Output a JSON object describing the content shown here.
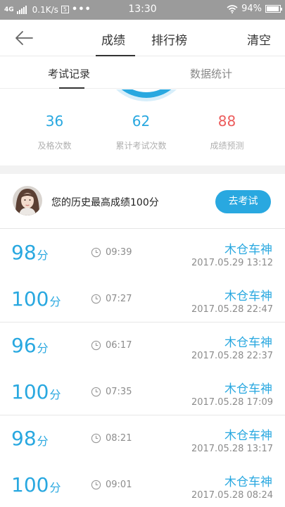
{
  "status_bar": {
    "network": "4G",
    "speed": "0.1K/s",
    "box_glyph": "5",
    "more": "•••",
    "time": "13:30",
    "battery": "94%",
    "battery_level": 0.94
  },
  "header": {
    "tabs": [
      {
        "label": "成绩",
        "active": true
      },
      {
        "label": "排行榜",
        "active": false
      }
    ],
    "clear_label": "清空",
    "back_icon": "arrow-left-icon"
  },
  "subtabs": [
    {
      "label": "考试记录",
      "active": true
    },
    {
      "label": "数据统计",
      "active": false
    }
  ],
  "stats": [
    {
      "value": "36",
      "label": "及格次数",
      "color": "#29a8e0"
    },
    {
      "value": "62",
      "label": "累计考试次数",
      "color": "#29a8e0"
    },
    {
      "value": "88",
      "label": "成绩预测",
      "color": "#ec5c5c"
    }
  ],
  "best": {
    "text": "您的历史最高成绩100分",
    "button_label": "去考试"
  },
  "records": [
    {
      "score": "98",
      "unit": "分",
      "duration": "09:39",
      "name": "木仓车神",
      "date": "2017.05.29   13:12"
    },
    {
      "score": "100",
      "unit": "分",
      "duration": "07:27",
      "name": "木仓车神",
      "date": "2017.05.28   22:47"
    },
    {
      "score": "96",
      "unit": "分",
      "duration": "06:17",
      "name": "木仓车神",
      "date": "2017.05.28   22:37"
    },
    {
      "score": "100",
      "unit": "分",
      "duration": "07:35",
      "name": "木仓车神",
      "date": "2017.05.28   17:09"
    },
    {
      "score": "98",
      "unit": "分",
      "duration": "08:21",
      "name": "木仓车神",
      "date": "2017.05.28   13:17"
    },
    {
      "score": "100",
      "unit": "分",
      "duration": "09:01",
      "name": "木仓车神",
      "date": "2017.05.28   08:24"
    }
  ],
  "colors": {
    "accent": "#29a8e0",
    "danger": "#ec5c5c",
    "status_bar": "#9b9b9b"
  }
}
